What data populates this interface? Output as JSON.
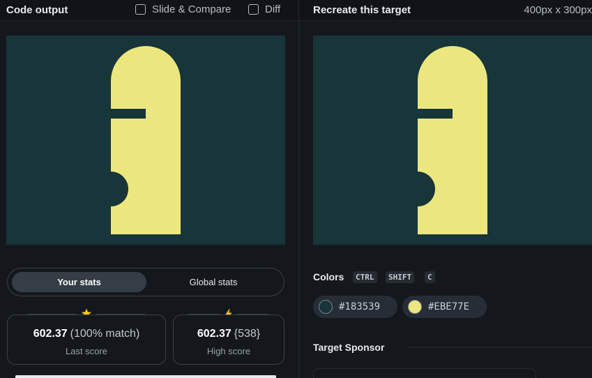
{
  "left": {
    "title": "Code output",
    "slide_compare_label": "Slide & Compare",
    "diff_label": "Diff",
    "toggle": {
      "active_label": "Your stats",
      "inactive_label": "Global stats"
    },
    "last_score": {
      "value": "602.37",
      "detail": "(100% match)",
      "label": "Last score",
      "icon": "star-icon"
    },
    "high_score": {
      "value": "602.37",
      "detail": "{538}",
      "label": "High score",
      "icon": "lightning-icon"
    }
  },
  "right": {
    "title": "Recreate this target",
    "size_label": "400px x 300px",
    "colors_heading": "Colors",
    "shortcut_keys": [
      "CTRL",
      "SHIFT",
      "C"
    ],
    "colors": [
      {
        "hex": "#183539"
      },
      {
        "hex": "#EBE77E"
      }
    ],
    "sponsor_heading": "Target Sponsor"
  },
  "theme": {
    "canvas_bg": "#183539",
    "shape_color": "#EBE77E",
    "star_color": "#f5c518"
  }
}
